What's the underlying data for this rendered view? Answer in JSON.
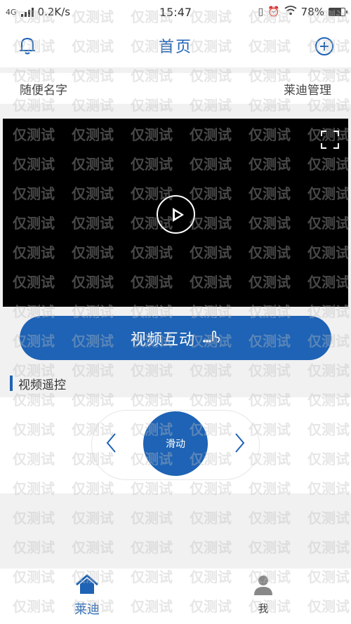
{
  "status_bar": {
    "network_type": "4G",
    "speed": "0.2K/s",
    "time": "15:47",
    "battery": "78%",
    "battery_fraction": 0.78
  },
  "header": {
    "title": "首页",
    "left_icon": "bell-icon",
    "right_icon": "plus-circle-icon"
  },
  "subheader": {
    "name": "随便名字",
    "manage_label": "莱迪管理"
  },
  "video": {
    "play_icon": "play-icon",
    "fullscreen_icon": "fullscreen-icon"
  },
  "interact_button": {
    "label": "视频互动",
    "icon": "hand-icon"
  },
  "remote_section": {
    "title": "视频遥控",
    "center_label": "滑动",
    "left_icon": "chevron-left-icon",
    "right_icon": "chevron-right-icon"
  },
  "tabbar": {
    "items": [
      {
        "label": "莱迪",
        "icon": "home-icon",
        "active": true
      },
      {
        "label": "我",
        "icon": "user-icon",
        "active": false
      }
    ]
  },
  "watermark": {
    "text": "仅测试"
  },
  "colors": {
    "accent": "#1e63b5",
    "background": "#f1f1f1",
    "video_bg": "#000000"
  }
}
